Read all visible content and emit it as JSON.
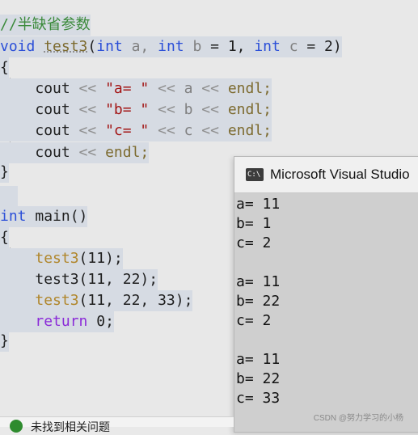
{
  "editor": {
    "comment": "//半缺省参数",
    "sig_void": "void",
    "sig_name": "test3",
    "sig_open": "(",
    "sig_int1": "int",
    "sig_a": " a,",
    "sig_int2": "int",
    "sig_b": " b",
    "sig_eq1": " = 1, ",
    "sig_int3": "int",
    "sig_c": " c",
    "sig_eq2": " = 2)",
    "brace_open": "{",
    "brace_close": "}",
    "cout_lines": [
      {
        "cout": "cout",
        "op1": " << ",
        "str": "\"a= \"",
        "op2": " << ",
        "var": "a",
        "op3": " << ",
        "endl": "endl;"
      },
      {
        "cout": "cout",
        "op1": " << ",
        "str": "\"b= \"",
        "op2": " << ",
        "var": "b",
        "op3": " << ",
        "endl": "endl;"
      },
      {
        "cout": "cout",
        "op1": " << ",
        "str": "\"c= \"",
        "op2": " << ",
        "var": "c",
        "op3": " << ",
        "endl": "endl;"
      }
    ],
    "last_cout": {
      "cout": "cout",
      "op": " << ",
      "endl": "endl;"
    },
    "main_int": "int",
    "main_name": " main()",
    "calls": [
      {
        "name": "test3",
        "args": "(11);"
      },
      {
        "name": "test3",
        "args": "(11, 22);"
      },
      {
        "name": "test3",
        "args": "(11, 22, 33);"
      }
    ],
    "return_kw": "return",
    "return_val": " 0;"
  },
  "console": {
    "title": "Microsoft Visual Studio",
    "icon_text": "C:\\",
    "output": [
      "a= 11",
      "b= 1",
      "c= 2",
      "",
      "a= 11",
      "b= 22",
      "c= 2",
      "",
      "a= 11",
      "b= 22",
      "c= 33"
    ]
  },
  "statusbar": {
    "text": "未找到相关问题"
  },
  "watermark": "CSDN @努力学习的小杨"
}
